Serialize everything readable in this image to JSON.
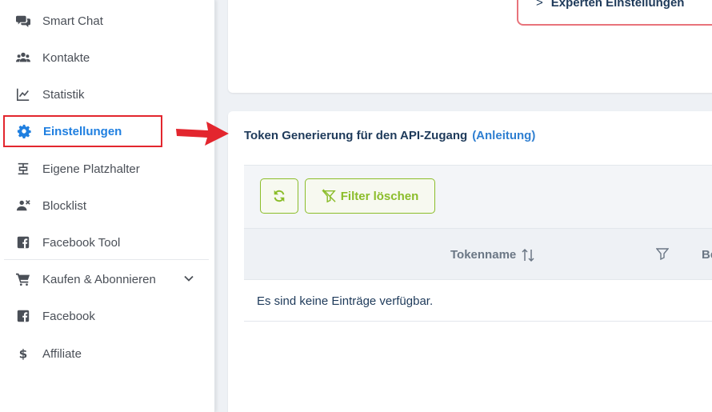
{
  "sidebar": {
    "items": [
      {
        "label": "Smart Chat",
        "icon": "chat-bubbles-icon"
      },
      {
        "label": "Kontakte",
        "icon": "users-icon"
      },
      {
        "label": "Statistik",
        "icon": "line-chart-icon"
      },
      {
        "label": "Einstellungen",
        "icon": "gear-icon",
        "active": true
      },
      {
        "label": "Eigene Platzhalter",
        "icon": "placeholder-icon"
      },
      {
        "label": "Blocklist",
        "icon": "user-block-icon"
      },
      {
        "label": "Facebook Tool",
        "icon": "facebook-icon"
      },
      {
        "label": "Kaufen & Abonnieren",
        "icon": "cart-icon"
      },
      {
        "label": "Facebook",
        "icon": "facebook-icon"
      },
      {
        "label": "Affiliate",
        "icon": "dollar-icon"
      }
    ]
  },
  "top_card": {
    "expert_label": "Experten Einstellungen"
  },
  "token_section": {
    "title": "Token Generierung für den API-Zugang",
    "link": "(Anleitung)"
  },
  "toolbar": {
    "filter_clear_label": "Filter löschen"
  },
  "table": {
    "columns": [
      "Tokenname",
      "Be"
    ],
    "empty_message": "Es sind keine Einträge verfügbar."
  },
  "colors": {
    "active": "#1f7fe0",
    "highlight_border": "#e3262e",
    "button_green": "#8bbd2a",
    "link_blue": "#2f7fd1",
    "heading": "#1e3a5a"
  }
}
